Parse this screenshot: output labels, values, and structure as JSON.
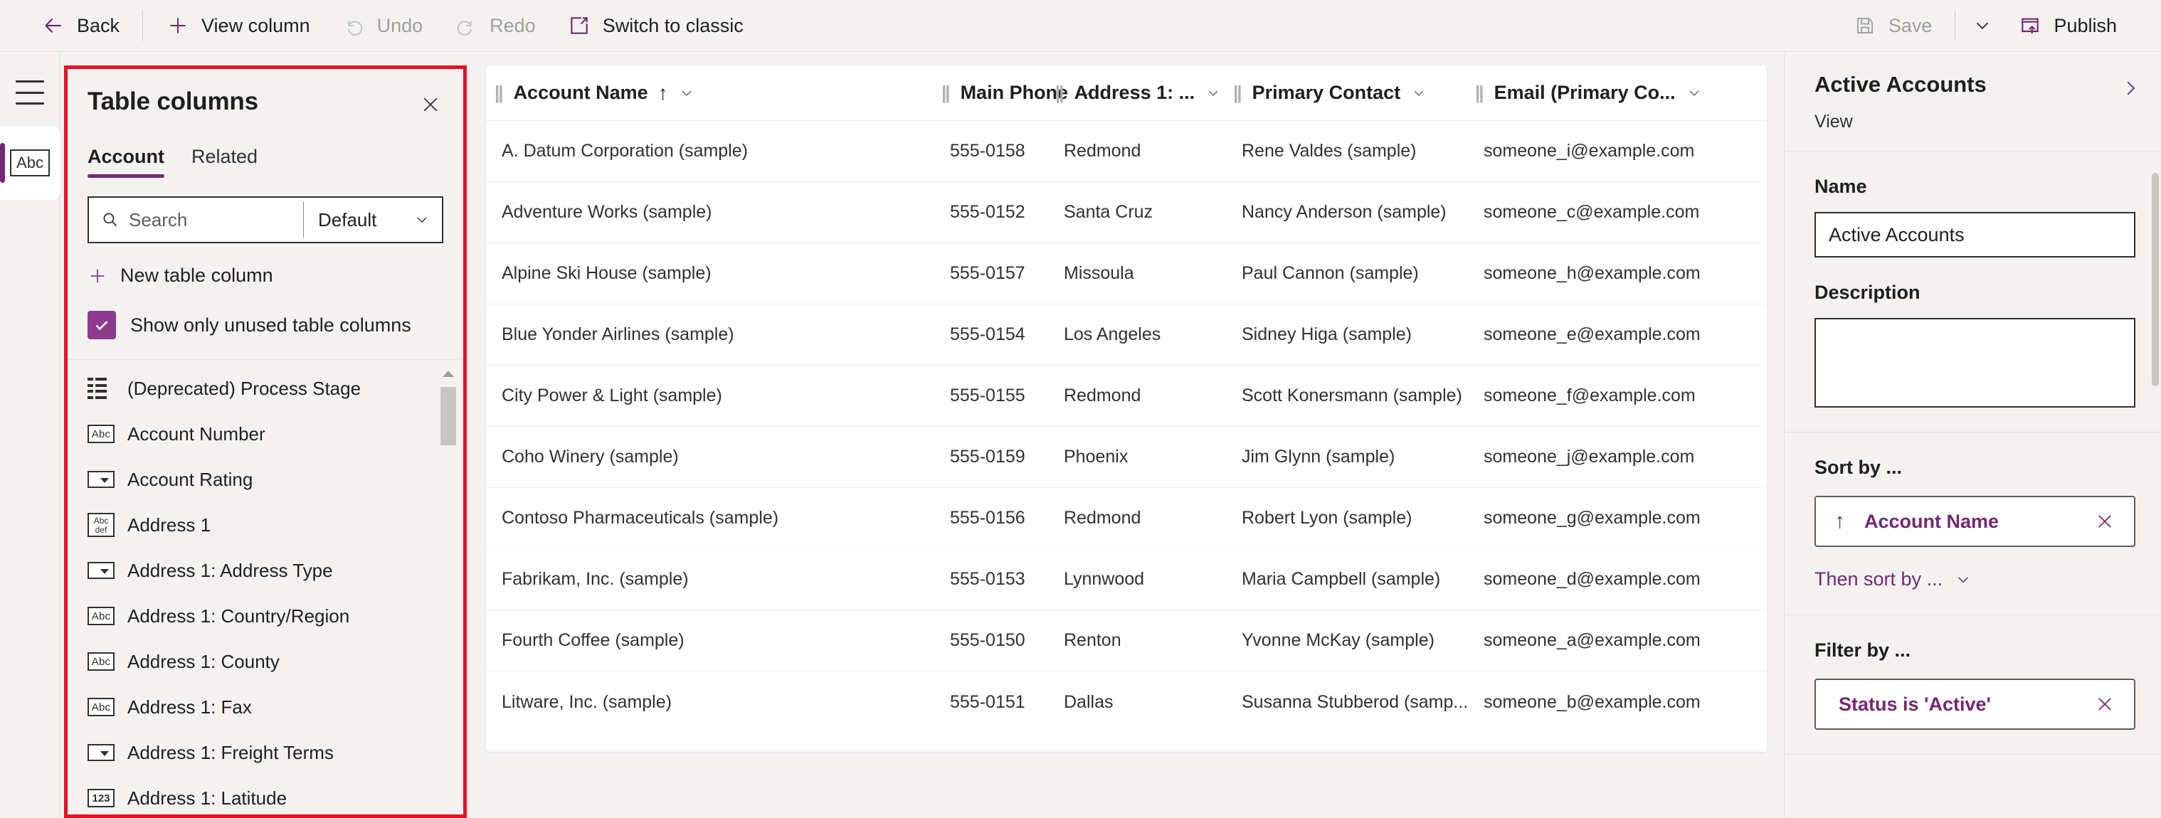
{
  "commandbar": {
    "back_label": "Back",
    "view_column_label": "View column",
    "undo_label": "Undo",
    "redo_label": "Redo",
    "switch_classic_label": "Switch to classic",
    "save_label": "Save",
    "publish_label": "Publish"
  },
  "rail": {
    "menu_label": "Menu",
    "item_label": "Abc"
  },
  "table_columns": {
    "title": "Table columns",
    "close_label": "Close",
    "tabs": [
      {
        "label": "Account",
        "active": true
      },
      {
        "label": "Related",
        "active": false
      }
    ],
    "search_placeholder": "Search",
    "filter_value": "Default",
    "new_column_label": "New table column",
    "show_unused_label": "Show only unused table columns",
    "show_unused_checked": true,
    "highlight_color": "#e81123",
    "columns": [
      {
        "label": "(Deprecated) Process Stage",
        "icon": "grid-icon"
      },
      {
        "label": "Account Number",
        "icon": "abc-icon"
      },
      {
        "label": "Account Rating",
        "icon": "optionset-icon"
      },
      {
        "label": "Address 1",
        "icon": "multiline-text-icon"
      },
      {
        "label": "Address 1: Address Type",
        "icon": "optionset-icon"
      },
      {
        "label": "Address 1: Country/Region",
        "icon": "abc-icon"
      },
      {
        "label": "Address 1: County",
        "icon": "abc-icon"
      },
      {
        "label": "Address 1: Fax",
        "icon": "abc-icon"
      },
      {
        "label": "Address 1: Freight Terms",
        "icon": "optionset-icon"
      },
      {
        "label": "Address 1: Latitude",
        "icon": "number-icon"
      }
    ]
  },
  "grid": {
    "headers": [
      {
        "label": "Account Name",
        "sorted": "asc"
      },
      {
        "label": "Main Phone",
        "sorted": ""
      },
      {
        "label": "Address 1: ...",
        "sorted": ""
      },
      {
        "label": "Primary Contact",
        "sorted": ""
      },
      {
        "label": "Email (Primary Co...",
        "sorted": ""
      }
    ],
    "rows": [
      [
        "A. Datum Corporation (sample)",
        "555-0158",
        "Redmond",
        "Rene Valdes (sample)",
        "someone_i@example.com"
      ],
      [
        "Adventure Works (sample)",
        "555-0152",
        "Santa Cruz",
        "Nancy Anderson (sample)",
        "someone_c@example.com"
      ],
      [
        "Alpine Ski House (sample)",
        "555-0157",
        "Missoula",
        "Paul Cannon (sample)",
        "someone_h@example.com"
      ],
      [
        "Blue Yonder Airlines (sample)",
        "555-0154",
        "Los Angeles",
        "Sidney Higa (sample)",
        "someone_e@example.com"
      ],
      [
        "City Power & Light (sample)",
        "555-0155",
        "Redmond",
        "Scott Konersmann (sample)",
        "someone_f@example.com"
      ],
      [
        "Coho Winery (sample)",
        "555-0159",
        "Phoenix",
        "Jim Glynn (sample)",
        "someone_j@example.com"
      ],
      [
        "Contoso Pharmaceuticals (sample)",
        "555-0156",
        "Redmond",
        "Robert Lyon (sample)",
        "someone_g@example.com"
      ],
      [
        "Fabrikam, Inc. (sample)",
        "555-0153",
        "Lynnwood",
        "Maria Campbell (sample)",
        "someone_d@example.com"
      ],
      [
        "Fourth Coffee (sample)",
        "555-0150",
        "Renton",
        "Yvonne McKay (sample)",
        "someone_a@example.com"
      ],
      [
        "Litware, Inc. (sample)",
        "555-0151",
        "Dallas",
        "Susanna Stubberod (samp...",
        "someone_b@example.com"
      ]
    ]
  },
  "properties": {
    "title": "Active Accounts",
    "subtitle": "View",
    "name_label": "Name",
    "name_value": "Active Accounts",
    "description_label": "Description",
    "description_value": "",
    "sort_label": "Sort by ...",
    "sort_pill": "Account Name",
    "sort_direction": "↑",
    "then_sort_label": "Then sort by ...",
    "filter_label": "Filter by ...",
    "filter_pill": "Status is 'Active'",
    "accent_color": "#742774"
  }
}
